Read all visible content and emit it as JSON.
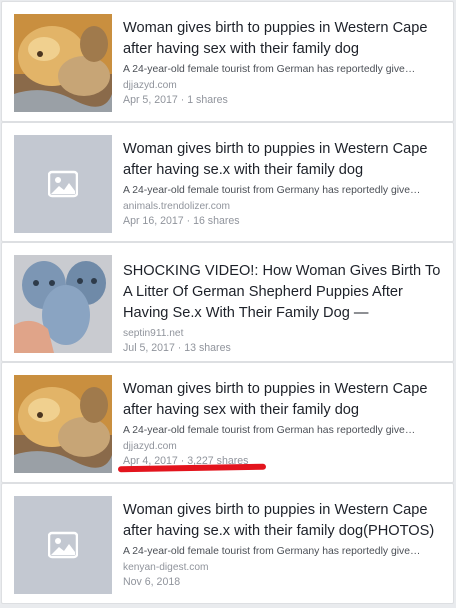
{
  "results": [
    {
      "title": "Woman gives birth to puppies in Western Cape after having sex with their family dog",
      "description": "A 24-year-old female tourist from German has reportedly give…",
      "source": "djjazyd.com",
      "meta": "Apr 5, 2017 · 1 shares",
      "thumbnail": "dog-photo"
    },
    {
      "title": "Woman gives birth to puppies in Western Cape after having se.x with their family dog",
      "description": "A 24-year-old female tourist from Germany has reportedly give…",
      "source": "animals.trendolizer.com",
      "meta": "Apr 16, 2017 · 16 shares",
      "thumbnail": "image-placeholder-icon"
    },
    {
      "title": "SHOCKING VIDEO!: How Woman Gives Birth To A Litter Of German Shepherd Puppies After Having Se.x With Their Family Dog —",
      "description": "",
      "source": "septin911.net",
      "meta": "Jul 5, 2017 · 13 shares",
      "thumbnail": "blue-figures-photo"
    },
    {
      "title": "Woman gives birth to puppies in Western Cape after having sex with their family dog",
      "description": "A 24-year-old female tourist from German has reportedly give…",
      "source": "djjazyd.com",
      "meta": "Apr 4, 2017 · 3,227 shares",
      "thumbnail": "dog-photo"
    },
    {
      "title": "Woman gives birth to puppies in Western Cape after having se.x with their family dog(PHOTOS)",
      "description": "A 24-year-old female tourist from Germany has reportedly give…",
      "source": "kenyan-digest.com",
      "meta": "Nov 6, 2018",
      "thumbnail": "image-placeholder-icon"
    }
  ],
  "colors": {
    "background": "#e9ebee",
    "title": "#1d2129",
    "muted": "#90949c",
    "highlight": "#e3141d"
  }
}
